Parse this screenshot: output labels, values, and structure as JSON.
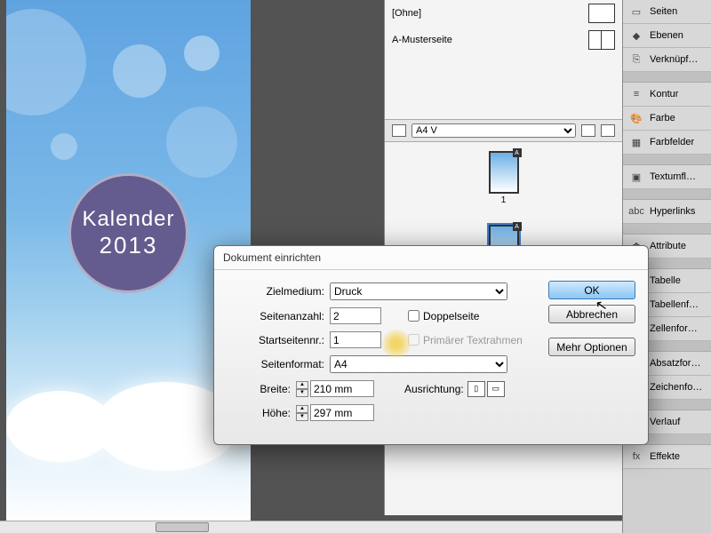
{
  "document": {
    "badge_line1": "Kalender",
    "badge_line2": "2013"
  },
  "masters": {
    "items": [
      {
        "label": "[Ohne]"
      },
      {
        "label": "A-Musterseite"
      }
    ]
  },
  "preset": {
    "selected": "A4 V",
    "options": [
      "A4 V"
    ]
  },
  "pages": {
    "thumbs": [
      {
        "num": "1",
        "marker": "A"
      },
      {
        "num": "",
        "marker": "A"
      }
    ]
  },
  "panels": [
    {
      "label": "Seiten",
      "icon": "▭"
    },
    {
      "label": "Ebenen",
      "icon": "◆"
    },
    {
      "label": "Verknüpf…",
      "icon": "⎘"
    },
    {
      "gap": true
    },
    {
      "label": "Kontur",
      "icon": "≡"
    },
    {
      "label": "Farbe",
      "icon": "🎨"
    },
    {
      "label": "Farbfelder",
      "icon": "▦"
    },
    {
      "gap": true
    },
    {
      "label": "Textumfl…",
      "icon": "▣"
    },
    {
      "gap": true
    },
    {
      "label": "Hyperlinks",
      "icon": "abc"
    },
    {
      "gap": true
    },
    {
      "label": "Attribute",
      "icon": "✿"
    },
    {
      "gap": true
    },
    {
      "label": "Tabelle",
      "icon": "▦"
    },
    {
      "label": "Tabellenf…",
      "icon": "▦"
    },
    {
      "label": "Zellenfor…",
      "icon": "▭"
    },
    {
      "gap": true
    },
    {
      "label": "Absatzfor…",
      "icon": "¶"
    },
    {
      "label": "Zeichenfo…",
      "icon": "A"
    },
    {
      "gap": true
    },
    {
      "label": "Verlauf",
      "icon": "▬"
    },
    {
      "gap": true
    },
    {
      "label": "Effekte",
      "icon": "fx"
    }
  ],
  "dialog": {
    "title": "Dokument einrichten",
    "labels": {
      "zielmedium": "Zielmedium:",
      "seitenanzahl": "Seitenanzahl:",
      "startseitennr": "Startseitennr.:",
      "seitenformat": "Seitenformat:",
      "breite": "Breite:",
      "hoehe": "Höhe:",
      "ausrichtung": "Ausrichtung:",
      "doppelseite": "Doppelseite",
      "primaer": "Primärer Textrahmen"
    },
    "values": {
      "zielmedium": "Druck",
      "seitenanzahl": "2",
      "startseitennr": "1",
      "seitenformat": "A4",
      "breite": "210 mm",
      "hoehe": "297 mm",
      "doppelseite_checked": false,
      "primaer_checked": false
    },
    "buttons": {
      "ok": "OK",
      "cancel": "Abbrechen",
      "more": "Mehr Optionen"
    }
  }
}
